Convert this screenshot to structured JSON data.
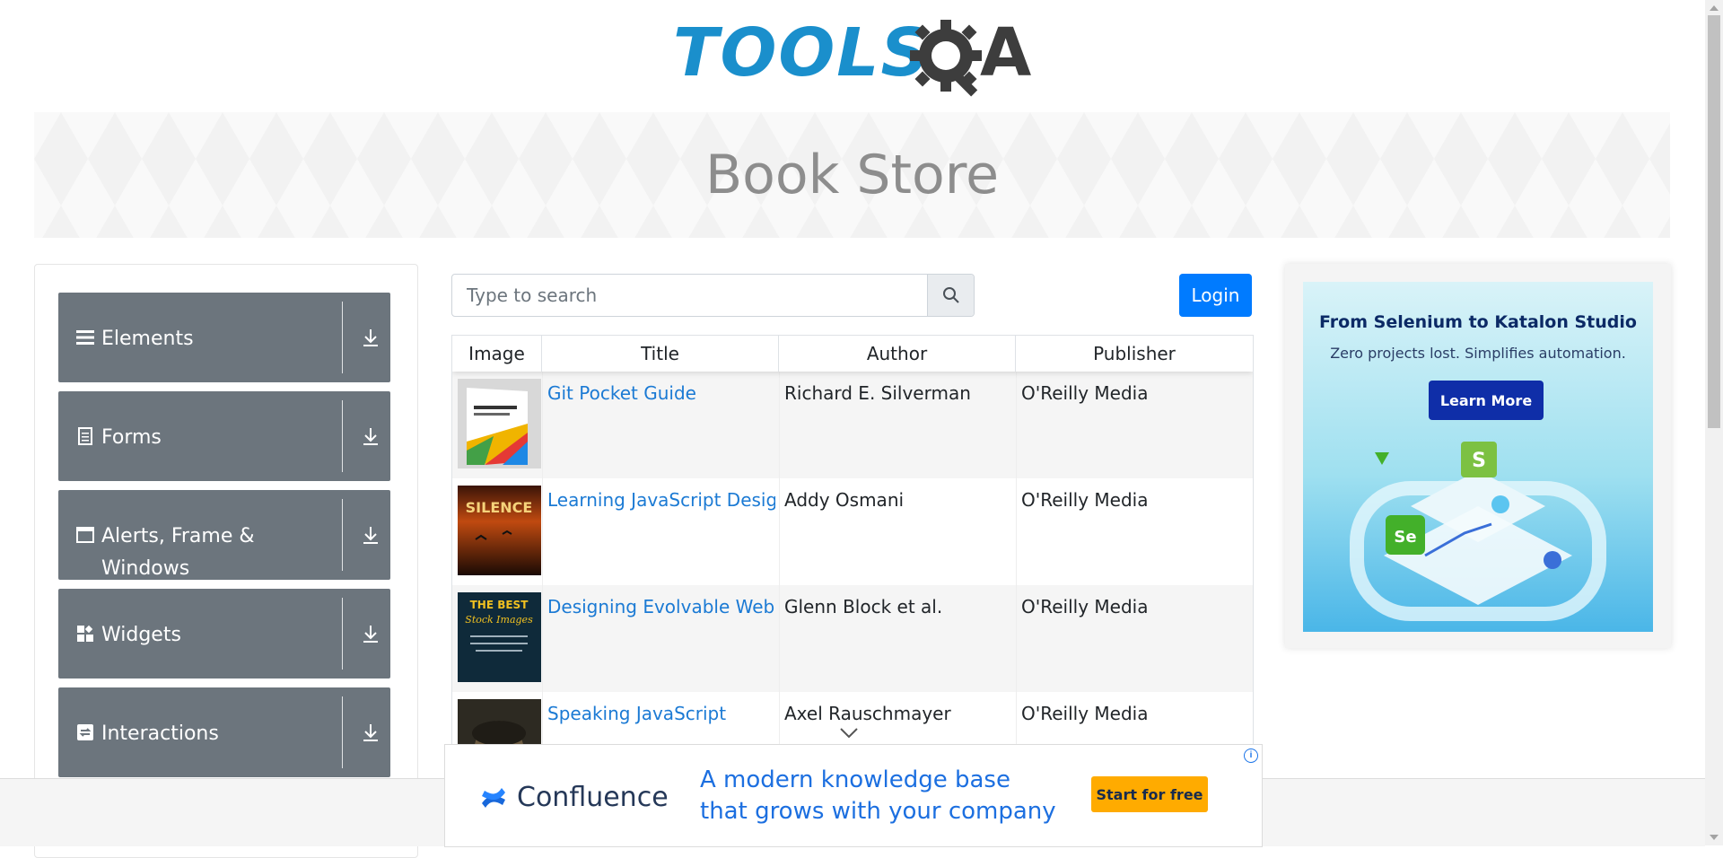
{
  "header": {
    "logo_text": "TOOLS",
    "logo_suffix": "A",
    "logo_brand_color": "#1a8fcc"
  },
  "banner": {
    "title": "Book Store"
  },
  "sidebar": {
    "groups": [
      {
        "label": "Elements",
        "icon": "hamburger-icon"
      },
      {
        "label": "Forms",
        "icon": "document-icon"
      },
      {
        "label": "Alerts, Frame & Windows",
        "icon": "window-icon"
      },
      {
        "label": "Widgets",
        "icon": "widgets-icon"
      },
      {
        "label": "Interactions",
        "icon": "interactions-icon"
      }
    ]
  },
  "search": {
    "placeholder": "Type to search",
    "value": ""
  },
  "login": {
    "label": "Login"
  },
  "table": {
    "headers": [
      "Image",
      "Title",
      "Author",
      "Publisher"
    ],
    "rows": [
      {
        "title": "Git Pocket Guide",
        "author": "Richard E. Silverman",
        "publisher": "O'Reilly Media",
        "cover": "business-design-cover"
      },
      {
        "title": "Learning JavaScript Design Patterns",
        "author": "Addy Osmani",
        "publisher": "O'Reilly Media",
        "cover": "silence-cover"
      },
      {
        "title": "Designing Evolvable Web APIs with ASP.NET",
        "author": "Glenn Block et al.",
        "publisher": "O'Reilly Media",
        "cover": "best-stock-images-cover"
      },
      {
        "title": "Speaking JavaScript",
        "author": "Axel Rauschmayer",
        "publisher": "O'Reilly Media",
        "cover": "portrait-cover"
      }
    ]
  },
  "right_ad": {
    "title": "From Selenium to Katalon Studio",
    "subtitle": "Zero projects lost. Simplifies automation.",
    "button": "Learn More"
  },
  "bottom_ad": {
    "brand": "Confluence",
    "copy": "A modern knowledge base that grows with your company",
    "button": "Start for free",
    "info": "i"
  },
  "colors": {
    "primary": "#007bff",
    "sidebar_group": "#6c757d",
    "link": "#1b7ad4",
    "confluence_cta": "#ffab00"
  }
}
